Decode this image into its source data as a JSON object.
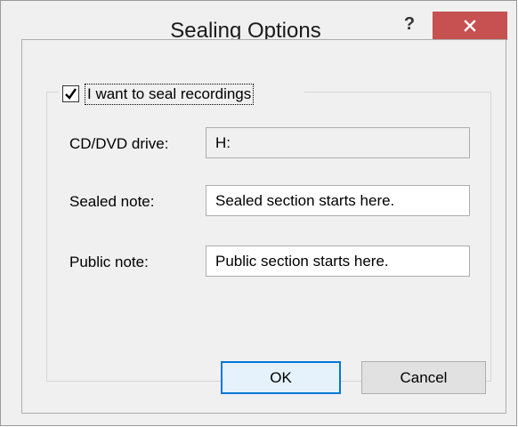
{
  "window": {
    "title": "Sealing Options",
    "help_label": "?",
    "close_color": "#c75050"
  },
  "seal": {
    "checkbox_label": "I want to seal recordings",
    "checked": true
  },
  "fields": {
    "drive_label": "CD/DVD drive:",
    "drive_value": "H:",
    "sealed_label": "Sealed note:",
    "sealed_value": "Sealed section starts here.",
    "public_label": "Public note:",
    "public_value": "Public section starts here."
  },
  "buttons": {
    "ok_label": "OK",
    "cancel_label": "Cancel"
  },
  "colors": {
    "accent": "#0078d7",
    "background": "#f0f0f0"
  }
}
